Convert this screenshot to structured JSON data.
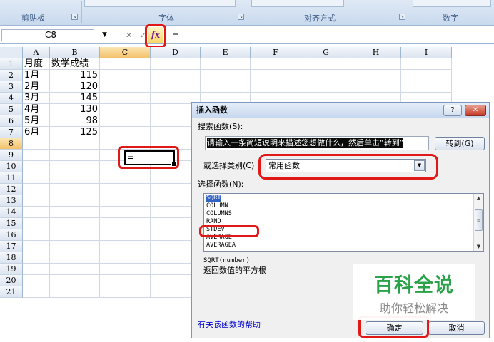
{
  "ribbon": {
    "groups": [
      {
        "label": "剪贴板"
      },
      {
        "label": "字体"
      },
      {
        "label": "对齐方式"
      },
      {
        "label": "数字"
      }
    ]
  },
  "formula_bar": {
    "name_box": "C8",
    "cancel_symbol": "✕",
    "enter_symbol": "✓",
    "fx_label": "fx",
    "formula": "="
  },
  "sheet": {
    "columns": [
      "A",
      "B",
      "C",
      "D",
      "E",
      "F",
      "G",
      "H",
      "I"
    ],
    "rows": [
      "1",
      "2",
      "3",
      "4",
      "5",
      "6",
      "7",
      "8",
      "9",
      "10",
      "11",
      "12",
      "13",
      "14",
      "15",
      "16",
      "17",
      "18",
      "19",
      "20",
      "21"
    ],
    "selected_column": "C",
    "selected_row": "8",
    "cells": [
      {
        "a": "月度",
        "b": "数学成绩"
      },
      {
        "a": "1月",
        "b": "115"
      },
      {
        "a": "2月",
        "b": "120"
      },
      {
        "a": "3月",
        "b": "145"
      },
      {
        "a": "4月",
        "b": "130"
      },
      {
        "a": "5月",
        "b": "98"
      },
      {
        "a": "6月",
        "b": "125"
      }
    ],
    "active_cell_value": "="
  },
  "dialog": {
    "title": "插入函数",
    "help_button": "?",
    "close_button": "✕",
    "search_label": "搜索函数(S):",
    "search_value": "请输入一条简短说明来描述您想做什么，然后单击“转到”",
    "go_button": "转到(G)",
    "category_label": "或选择类别(C)",
    "category_value": "常用函数",
    "function_list_label": "选择函数(N):",
    "functions": [
      "SQRT",
      "COLUMN",
      "COLUMNS",
      "RAND",
      "STDEV",
      "AVERAGE",
      "AVERAGEA"
    ],
    "selected_function": "SQRT",
    "syntax": "SQRT(number)",
    "description": "返回数值的平方根",
    "help_link": "有关该函数的帮助",
    "ok_button": "确定",
    "cancel_button": "取消"
  },
  "watermark": {
    "title": "百科全说",
    "subtitle": "助你轻松解决"
  }
}
